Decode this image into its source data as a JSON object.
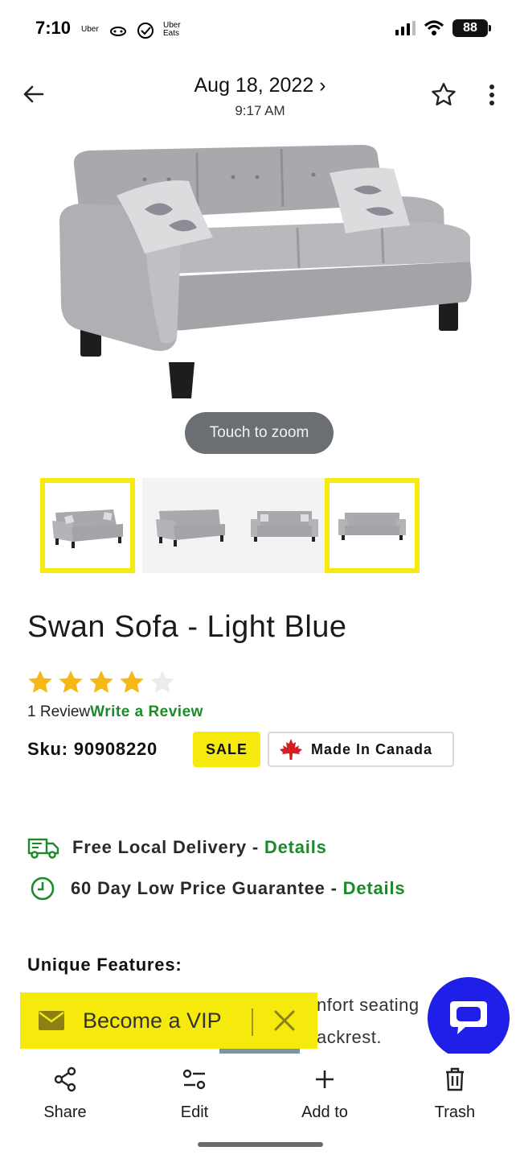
{
  "status_bar": {
    "time": "7:10",
    "apps": [
      "Uber",
      "Uber Eats"
    ],
    "battery": "88"
  },
  "header": {
    "date": "Aug 18, 2022 ›",
    "time": "9:17 AM"
  },
  "image": {
    "zoom_hint": "Touch to zoom"
  },
  "thumbnails": [
    {
      "selected": true
    },
    {
      "selected": false
    },
    {
      "selected": false
    },
    {
      "selected": true
    }
  ],
  "product": {
    "title": "Swan Sofa - Light Blue",
    "rating": 4,
    "rating_max": 5,
    "review_count": "1 Review",
    "write_review": "Write a Review",
    "sku": "Sku: 90908220",
    "sale_badge": "SALE",
    "origin_badge": "Made In Canada"
  },
  "info": {
    "delivery_text": "Free Local Delivery - ",
    "delivery_link": "Details",
    "guarantee_text": "60 Day Low Price Guarantee - ",
    "guarantee_link": "Details"
  },
  "features": {
    "title": "Unique Features:",
    "line1": "nfort seating",
    "line2": "ackrest."
  },
  "vip": {
    "label": "Become a VIP"
  },
  "bottom_bar": {
    "share": "Share",
    "edit": "Edit",
    "add_to": "Add to",
    "trash": "Trash"
  },
  "colors": {
    "accent_yellow": "#f6ea0c",
    "link_green": "#1b8a2a",
    "chat_blue": "#1f1fe8",
    "star_gold": "#f5b817"
  }
}
